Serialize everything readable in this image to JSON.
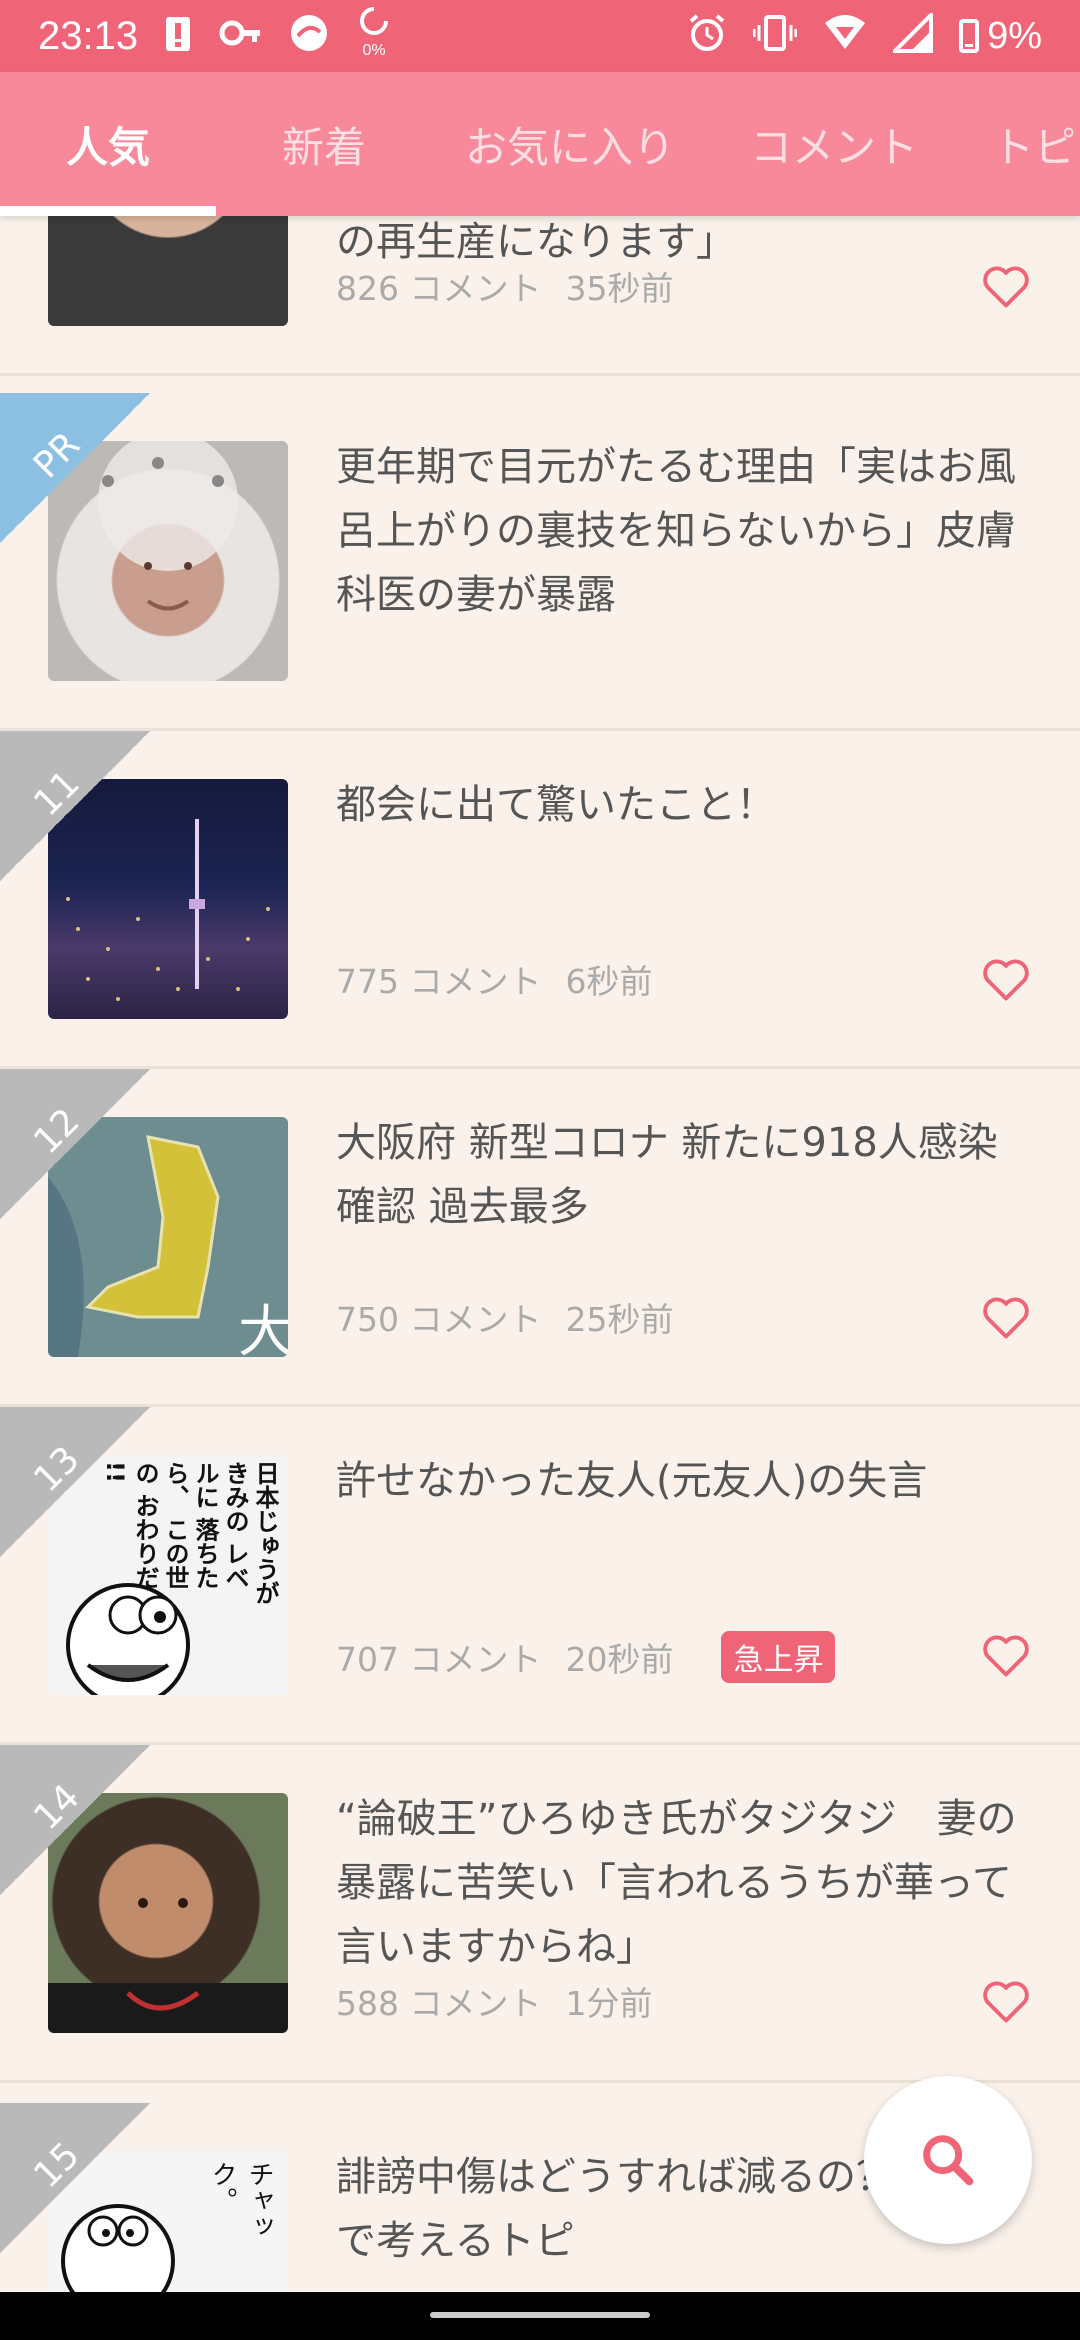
{
  "status_bar": {
    "time": "23:13",
    "left_icons": [
      "battery-alert-icon",
      "key-icon",
      "app-icon",
      "data-saver-icon"
    ],
    "right_icons": [
      "alarm-icon",
      "vibrate-icon",
      "wifi-icon",
      "signal-icon",
      "battery-icon"
    ],
    "battery_percent": "9%",
    "data_saver_label": "0%"
  },
  "tabs": [
    {
      "label": "人気",
      "active": true
    },
    {
      "label": "新着",
      "active": false
    },
    {
      "label": "お気に入り",
      "active": false
    },
    {
      "label": "コメント",
      "active": false
    },
    {
      "label": "トピ",
      "active": false
    }
  ],
  "items": [
    {
      "rank": "",
      "title": "の再生産になります」",
      "comments": "826 コメント",
      "time": "35秒前",
      "badge": ""
    },
    {
      "rank": "PR",
      "title": "更年期で目元がたるむ理由「実はお風呂上がりの裏技を知らないから」皮膚科医の妻が暴露",
      "comments": "",
      "time": "",
      "badge": ""
    },
    {
      "rank": "11",
      "title": "都会に出て驚いたこと！",
      "comments": "775 コメント",
      "time": "6秒前",
      "badge": ""
    },
    {
      "rank": "12",
      "title": "大阪府 新型コロナ 新たに918人感染確認 過去最多",
      "comments": "750 コメント",
      "time": "25秒前",
      "badge": ""
    },
    {
      "rank": "13",
      "title": "許せなかった友人(元友人)の失言",
      "comments": "707 コメント",
      "time": "20秒前",
      "badge": "急上昇"
    },
    {
      "rank": "14",
      "title": "“論破王”ひろゆき氏がタジタジ　妻の暴露に苦笑い「言われるうちが華って言いますからね」",
      "comments": "588 コメント",
      "time": "1分前",
      "badge": ""
    },
    {
      "rank": "15",
      "title": "誹謗中傷はどうすれば減るの？みんなで考えるトピ",
      "comments": "",
      "time": "",
      "badge": ""
    }
  ],
  "thumb_text": {
    "map_char": "大",
    "manga_text": "日本じゅうが きみの レベルに 落ちたら、 この世の おわりだ !!",
    "doraemon_text": "チャック。"
  },
  "fab": {
    "icon": "search-icon"
  },
  "colors": {
    "status_bar": "#f06478",
    "tab_bar": "#f7899a",
    "background": "#faf2ea",
    "accent": "#f06478"
  }
}
